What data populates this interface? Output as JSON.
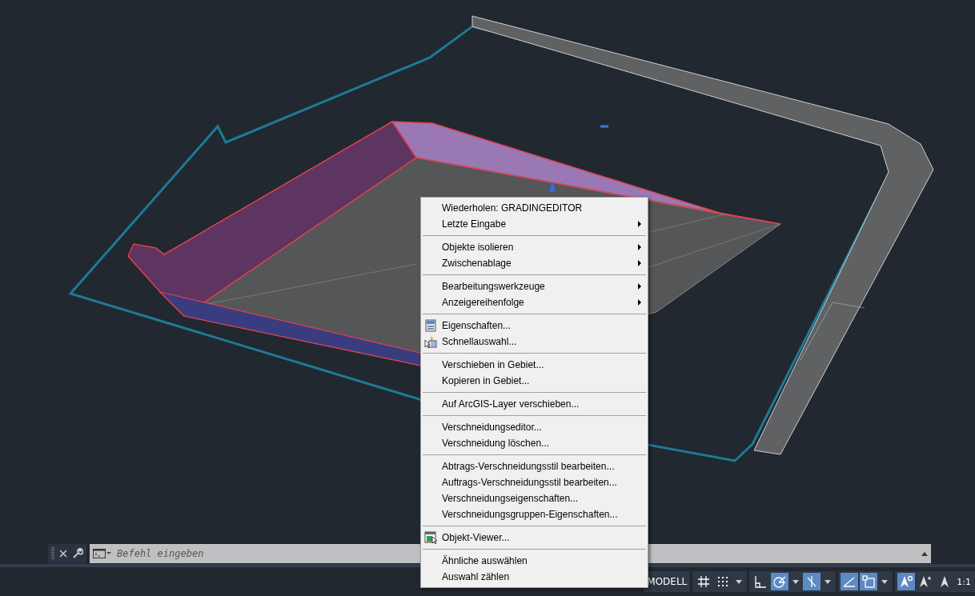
{
  "command_line": {
    "placeholder": "Befehl eingeben"
  },
  "context_menu": {
    "groups": [
      [
        {
          "label": "Wiederholen: GRADINGEDITOR",
          "submenu": false,
          "kind": "plain"
        },
        {
          "label": "Letzte Eingabe",
          "submenu": true,
          "kind": "plain"
        }
      ],
      [
        {
          "label": "Objekte isolieren",
          "submenu": true,
          "kind": "plain"
        },
        {
          "label": "Zwischenablage",
          "submenu": true,
          "kind": "plain"
        }
      ],
      [
        {
          "label": "Bearbeitungswerkzeuge",
          "submenu": true,
          "kind": "plain"
        },
        {
          "label": "Anzeigereihenfolge",
          "submenu": true,
          "kind": "plain"
        }
      ],
      [
        {
          "label": "Eigenschaften...",
          "submenu": false,
          "kind": "properties"
        },
        {
          "label": "Schnellauswahl...",
          "submenu": false,
          "kind": "quickselect"
        }
      ],
      [
        {
          "label": "Verschieben in Gebiet...",
          "submenu": false,
          "kind": "plain"
        },
        {
          "label": "Kopieren in Gebiet...",
          "submenu": false,
          "kind": "plain"
        }
      ],
      [
        {
          "label": "Auf ArcGIS-Layer verschieben...",
          "submenu": false,
          "kind": "plain"
        }
      ],
      [
        {
          "label": "Verschneidungseditor...",
          "submenu": false,
          "kind": "plain"
        },
        {
          "label": "Verschneidung löschen...",
          "submenu": false,
          "kind": "plain"
        }
      ],
      [
        {
          "label": "Abtrags-Verschneidungsstil bearbeiten...",
          "submenu": false,
          "kind": "plain"
        },
        {
          "label": "Auftrags-Verschneidungsstil bearbeiten...",
          "submenu": false,
          "kind": "plain"
        },
        {
          "label": "Verschneidungseigenschaften...",
          "submenu": false,
          "kind": "plain"
        },
        {
          "label": "Verschneidungsgruppen-Eigenschaften...",
          "submenu": false,
          "kind": "plain"
        }
      ],
      [
        {
          "label": "Objekt-Viewer...",
          "submenu": false,
          "kind": "viewer"
        }
      ],
      [
        {
          "label": "Ähnliche auswählen",
          "submenu": false,
          "kind": "plain"
        },
        {
          "label": "Auswahl zählen",
          "submenu": false,
          "kind": "plain"
        }
      ]
    ]
  },
  "status_bar": {
    "model_tab": "MODELL",
    "scale": "1:1",
    "groups": [
      [
        {
          "kind": "grid",
          "on": false
        },
        {
          "kind": "snap",
          "on": false
        },
        {
          "kind": "dropdown",
          "on": false
        }
      ],
      [
        {
          "kind": "ortho",
          "on": false
        },
        {
          "kind": "polar",
          "on": true
        },
        {
          "kind": "dropdown",
          "on": false
        },
        {
          "kind": "isodraft",
          "on": true
        },
        {
          "kind": "dropdown",
          "on": false
        }
      ],
      [
        {
          "kind": "tracking",
          "on": true
        },
        {
          "kind": "osnap",
          "on": true
        },
        {
          "kind": "dropdown",
          "on": false
        }
      ],
      [
        {
          "kind": "annotation",
          "on": true
        },
        {
          "kind": "autoscale",
          "on": false
        },
        {
          "kind": "annoscale",
          "on": false
        }
      ]
    ]
  }
}
